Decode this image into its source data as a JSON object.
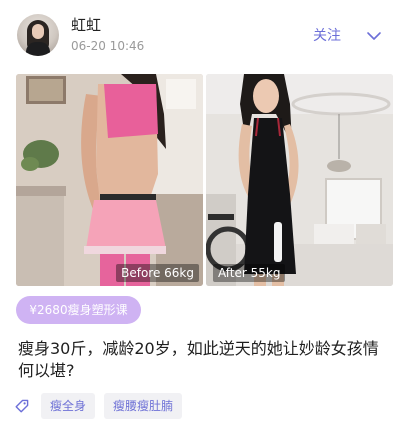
{
  "post": {
    "author": {
      "name": "虹虹"
    },
    "time": "06-20 10:46",
    "follow_label": "关注"
  },
  "photos": {
    "before_label": "Before 66kg",
    "after_label": "After 55kg"
  },
  "course_tag": "¥2680瘦身塑形课",
  "title": "瘦身30斤，减龄20岁，如此逆天的她让妙龄女孩情何以堪?",
  "topics": [
    "瘦全身",
    "瘦腰瘦肚腩"
  ],
  "colors": {
    "accent": "#6c6fd8",
    "course_tag_bg": "#cfb3f3",
    "chip_bg": "#f1f1f4",
    "top_pink": "#e8609a",
    "skirt_pink": "#f5a3b8"
  },
  "icons": {
    "more": "chevron-down-icon",
    "topic": "tag-icon"
  }
}
